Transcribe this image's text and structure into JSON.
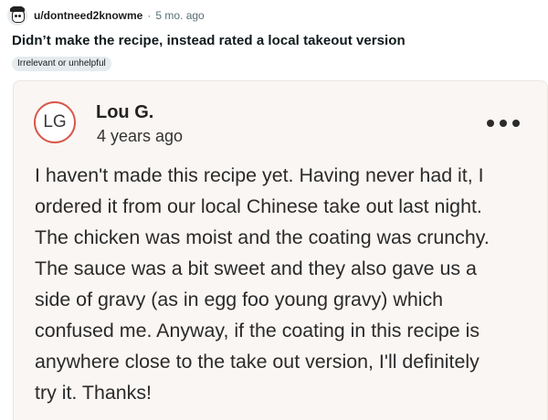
{
  "post": {
    "username": "u/dontneed2knowme",
    "separator": "·",
    "timestamp": "5 mo. ago",
    "title": "Didn’t make the recipe, instead rated a local takeout version",
    "flair": "Irrelevant or unhelpful",
    "avatar_icon": "snoo-avatar-icon"
  },
  "review": {
    "initials": "LG",
    "name": "Lou G.",
    "age": "4 years ago",
    "more_icon": "more-options-icon",
    "text": "I haven't made this recipe yet. Having never had it, I\nordered it from our local Chinese take out last night.\nThe chicken was moist and the coating was crunchy.\nThe sauce was a bit sweet and they also gave us a\nside of gravy (as in egg foo young gravy) which\nconfused me. Anyway, if the coating in this recipe is\nanywhere close to the take out version, I'll definitely\ntry it. Thanks!"
  },
  "colors": {
    "card_background": "#faf6f3",
    "avatar_ring": "#d9574b",
    "meta_text": "#576f76",
    "flair_background": "#e5ebee"
  }
}
